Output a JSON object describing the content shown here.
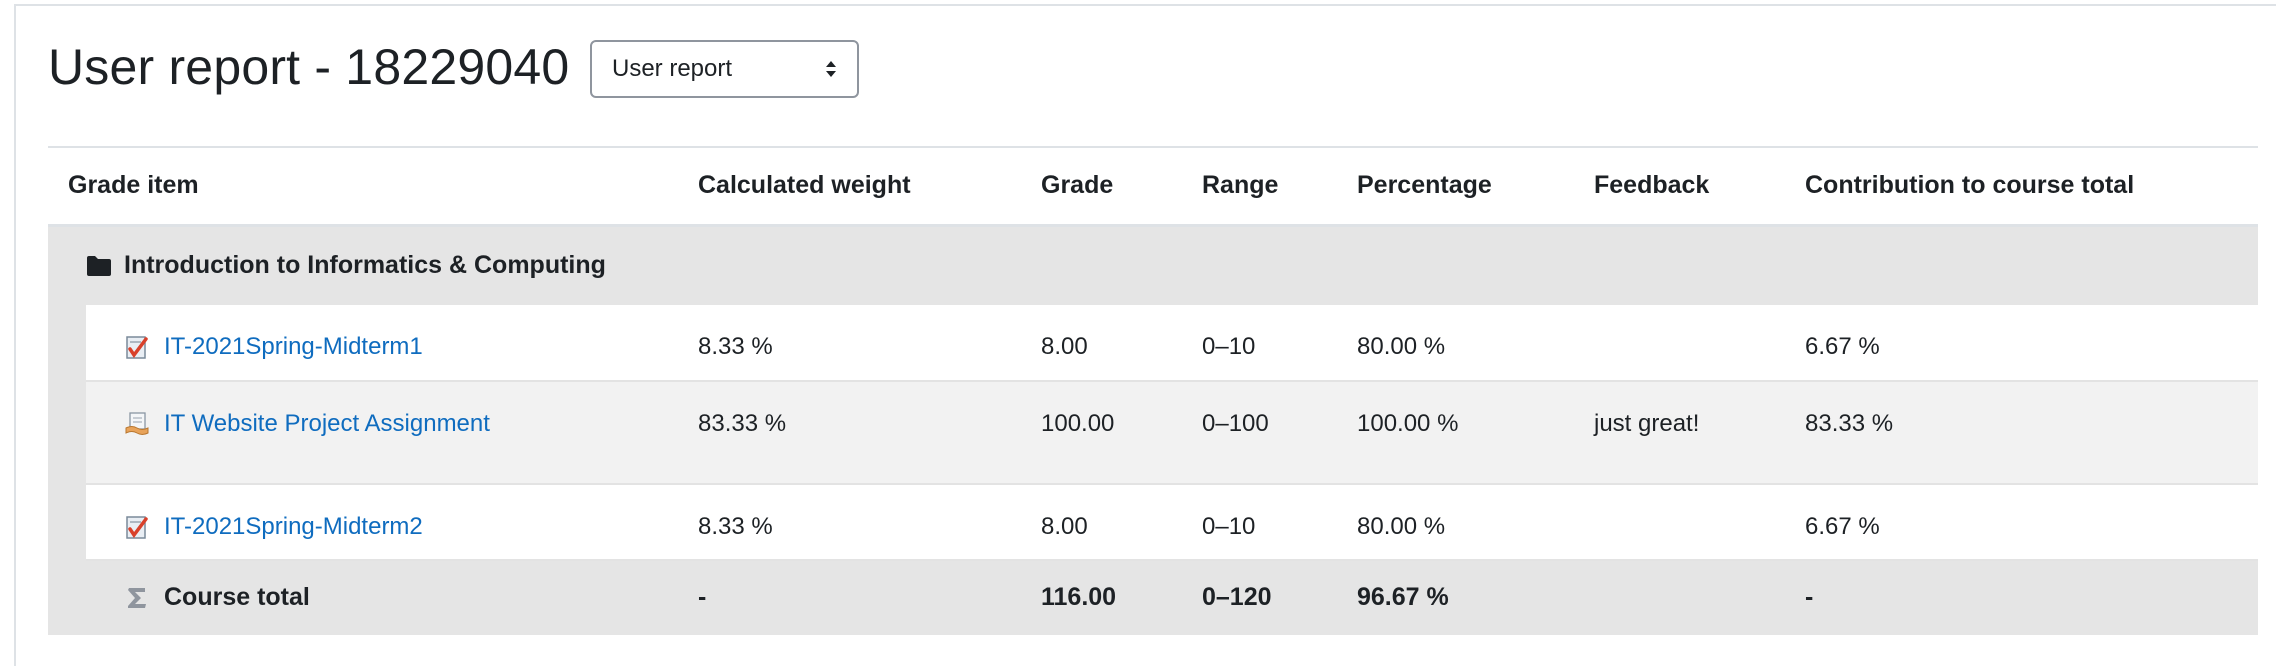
{
  "header": {
    "title": "User report - 18229040",
    "report_select": {
      "selected": "User report"
    }
  },
  "table": {
    "columns": [
      "Grade item",
      "Calculated weight",
      "Grade",
      "Range",
      "Percentage",
      "Feedback",
      "Contribution to course total"
    ],
    "category": {
      "name": "Introduction to Informatics & Computing",
      "icon": "folder-icon"
    },
    "rows": [
      {
        "name": "IT-2021Spring-Midterm1",
        "icon": "quiz-icon",
        "weight": "8.33 %",
        "grade": "8.00",
        "range": "0–10",
        "percentage": "80.00 %",
        "feedback": "",
        "contribution": "6.67 %"
      },
      {
        "name": "IT Website Project Assignment",
        "icon": "assignment-icon",
        "weight": "83.33 %",
        "grade": "100.00",
        "range": "0–100",
        "percentage": "100.00 %",
        "feedback": "just great!",
        "contribution": "83.33 %"
      },
      {
        "name": "IT-2021Spring-Midterm2",
        "icon": "quiz-icon",
        "weight": "8.33 %",
        "grade": "8.00",
        "range": "0–10",
        "percentage": "80.00 %",
        "feedback": "",
        "contribution": "6.67 %"
      }
    ],
    "total": {
      "name": "Course total",
      "icon": "sigma-icon",
      "weight": "-",
      "grade": "116.00",
      "range": "0–120",
      "percentage": "96.67 %",
      "feedback": "",
      "contribution": "-"
    }
  }
}
